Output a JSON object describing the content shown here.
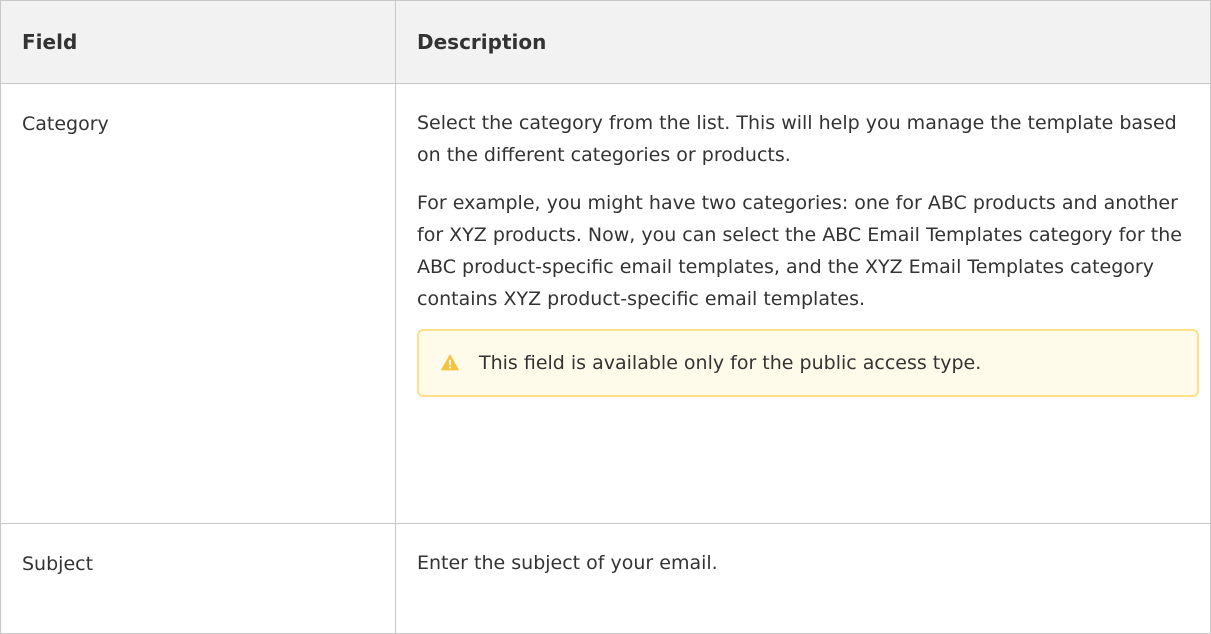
{
  "table": {
    "headers": {
      "field": "Field",
      "description": "Description"
    },
    "rows": [
      {
        "field": "Category",
        "description_paragraphs": [
          "Select the category from the list. This will help you manage the template based on the different categories or products.",
          "For example, you might have two categories: one for ABC products and another for XYZ products. Now, you can select the ABC Email Templates category for the ABC product-specific email templates, and the XYZ Email Templates category contains XYZ product-specific email templates."
        ],
        "warning": {
          "icon": "warning-triangle-icon",
          "text": "This field is available only for the public access type."
        }
      },
      {
        "field": "Subject",
        "description_paragraphs": [
          "Enter the subject of your email."
        ]
      }
    ]
  },
  "colors": {
    "header_bg": "#f2f2f2",
    "border": "#c8c8c8",
    "warning_bg": "#fffbea",
    "warning_border": "#ffe08a",
    "warning_icon": "#f5c242"
  }
}
